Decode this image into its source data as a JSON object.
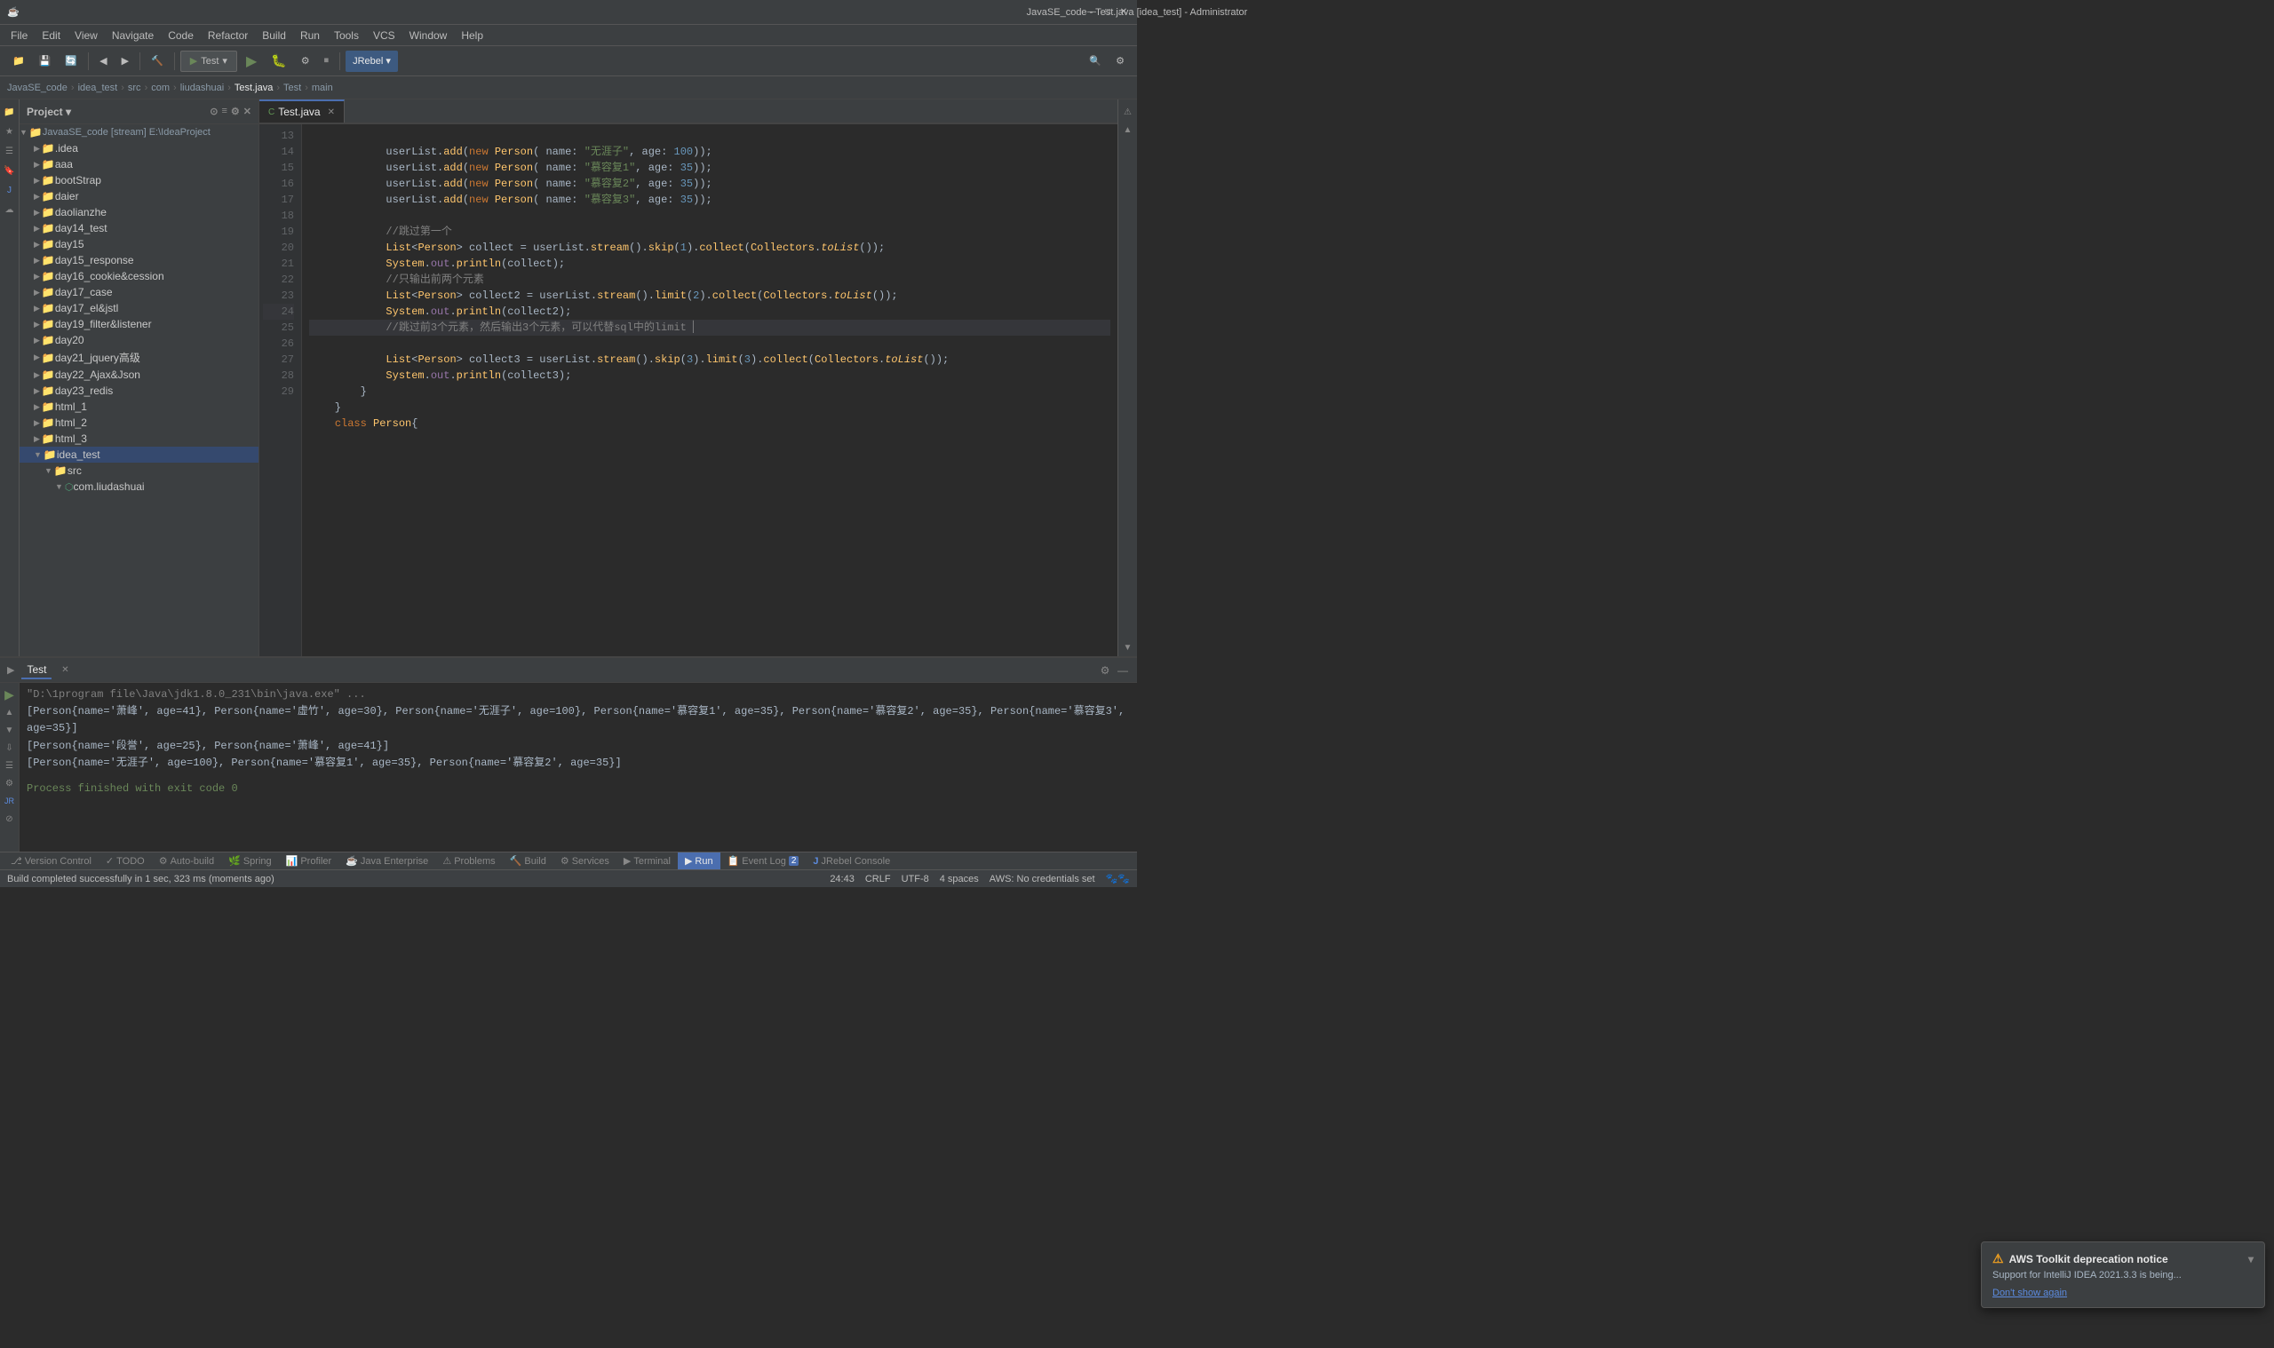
{
  "titlebar": {
    "title": "JavaSE_code - Test.java [idea_test] - Administrator",
    "app_icon": "☕",
    "controls": [
      "—",
      "□",
      "✕"
    ]
  },
  "menubar": {
    "items": [
      "File",
      "Edit",
      "View",
      "Navigate",
      "Code",
      "Refactor",
      "Build",
      "Run",
      "Tools",
      "VCS",
      "Window",
      "Help"
    ]
  },
  "toolbar": {
    "run_config": "Test",
    "jrebel": "JRebel ▾"
  },
  "breadcrumb": {
    "items": [
      "JavaSE_code",
      "idea_test",
      "src",
      "com",
      "liudashuai",
      "Test.java",
      "Test",
      "main"
    ]
  },
  "project_panel": {
    "title": "Project",
    "root": "JavaaSE_code [stream]  E:\\IdeaProject",
    "items": [
      {
        "label": ".idea",
        "indent": 1,
        "type": "folder",
        "collapsed": true
      },
      {
        "label": "aaa",
        "indent": 1,
        "type": "folder",
        "collapsed": true
      },
      {
        "label": "bootStrap",
        "indent": 1,
        "type": "folder",
        "collapsed": true
      },
      {
        "label": "daier",
        "indent": 1,
        "type": "folder",
        "collapsed": true
      },
      {
        "label": "daolianzhe",
        "indent": 1,
        "type": "folder",
        "collapsed": true
      },
      {
        "label": "day14_test",
        "indent": 1,
        "type": "folder",
        "collapsed": true
      },
      {
        "label": "day15",
        "indent": 1,
        "type": "folder",
        "collapsed": true
      },
      {
        "label": "day15_response",
        "indent": 1,
        "type": "folder",
        "collapsed": true
      },
      {
        "label": "day16_cookie&cession",
        "indent": 1,
        "type": "folder",
        "collapsed": true
      },
      {
        "label": "day17_case",
        "indent": 1,
        "type": "folder",
        "collapsed": true
      },
      {
        "label": "day17_el&jstl",
        "indent": 1,
        "type": "folder",
        "collapsed": true
      },
      {
        "label": "day19_filter&listener",
        "indent": 1,
        "type": "folder",
        "collapsed": true
      },
      {
        "label": "day20",
        "indent": 1,
        "type": "folder",
        "collapsed": true
      },
      {
        "label": "day21_jquery高级",
        "indent": 1,
        "type": "folder",
        "collapsed": true
      },
      {
        "label": "day22_Ajax&Json",
        "indent": 1,
        "type": "folder",
        "collapsed": true
      },
      {
        "label": "day23_redis",
        "indent": 1,
        "type": "folder",
        "collapsed": true
      },
      {
        "label": "html_1",
        "indent": 1,
        "type": "folder",
        "collapsed": true
      },
      {
        "label": "html_2",
        "indent": 1,
        "type": "folder",
        "collapsed": true
      },
      {
        "label": "html_3",
        "indent": 1,
        "type": "folder",
        "collapsed": true
      },
      {
        "label": "idea_test",
        "indent": 1,
        "type": "folder",
        "expanded": true
      },
      {
        "label": "src",
        "indent": 2,
        "type": "folder",
        "expanded": true
      },
      {
        "label": "com.liudashuai",
        "indent": 3,
        "type": "package",
        "expanded": true
      }
    ]
  },
  "editor": {
    "tab_label": "Test.java",
    "tab_icon": "C",
    "lines": [
      {
        "num": 13,
        "code": "            userList.add(new Person( name: \"无涯子\", age: 100));"
      },
      {
        "num": 14,
        "code": "            userList.add(new Person( name: \"慕容复1\", age: 35));"
      },
      {
        "num": 15,
        "code": "            userList.add(new Person( name: \"慕容复2\", age: 35));"
      },
      {
        "num": 16,
        "code": "            userList.add(new Person( name: \"慕容复3\", age: 35));"
      },
      {
        "num": 17,
        "code": ""
      },
      {
        "num": 18,
        "code": "            //跳过第一个"
      },
      {
        "num": 19,
        "code": "            List<Person> collect = userList.stream().skip(1).collect(Collectors.toList());"
      },
      {
        "num": 20,
        "code": "            System.out.println(collect);"
      },
      {
        "num": 21,
        "code": "            //只输出前两个元素"
      },
      {
        "num": 22,
        "code": "            List<Person> collect2 = userList.stream().limit(2).collect(Collectors.toList());"
      },
      {
        "num": 23,
        "code": "            System.out.println(collect2);"
      },
      {
        "num": 24,
        "code": "            //跳过前3个元素，然后输出3个元素，可以代替sql中的limit ▏"
      },
      {
        "num": 25,
        "code": "            List<Person> collect3 = userList.stream().skip(3).limit(3).collect(Collectors.toList());"
      },
      {
        "num": 26,
        "code": "            System.out.println(collect3);"
      },
      {
        "num": 27,
        "code": "        }"
      },
      {
        "num": 28,
        "code": "    }"
      },
      {
        "num": 29,
        "code": "    class Person{"
      }
    ]
  },
  "run_panel": {
    "tab_label": "Test",
    "command_line": "\"D:\\1program file\\Java\\jdk1.8.0_231\\bin\\java.exe\" ...",
    "output_lines": [
      "[Person{name='萧峰', age=41}, Person{name='虚竹', age=30}, Person{name='无涯子', age=100}, Person{name='慕容复1', age=35}, Person{name='慕容复2', age=35}, Person{name='慕容复3', age=35}]",
      "[Person{name='段誉', age=25}, Person{name='萧峰', age=41}]",
      "[Person{name='无涯子', age=100}, Person{name='慕容复1', age=35}, Person{name='慕容复2', age=35}]"
    ],
    "finish_msg": "Process finished with exit code 0"
  },
  "bottom_tabs": {
    "items": [
      {
        "label": "Version Control",
        "icon": "⎇",
        "active": false
      },
      {
        "label": "TODO",
        "icon": "✓",
        "active": false
      },
      {
        "label": "Auto-build",
        "icon": "⚙",
        "active": false
      },
      {
        "label": "Spring",
        "icon": "🌱",
        "active": false
      },
      {
        "label": "Profiler",
        "icon": "📊",
        "active": false
      },
      {
        "label": "Java Enterprise",
        "icon": "☕",
        "active": false
      },
      {
        "label": "Problems",
        "icon": "⚠",
        "badge": "",
        "active": false
      },
      {
        "label": "Build",
        "icon": "🔨",
        "active": false
      },
      {
        "label": "Services",
        "icon": "⚙",
        "active": false
      },
      {
        "label": "Terminal",
        "icon": "▶",
        "active": false
      },
      {
        "label": "Run",
        "icon": "▶",
        "active": true
      },
      {
        "label": "Event Log",
        "icon": "📋",
        "badge": "2",
        "active": false
      },
      {
        "label": "JRebel Console",
        "icon": "J",
        "active": false
      }
    ]
  },
  "statusbar": {
    "build_msg": "Build completed successfully in 1 sec, 323 ms (moments ago)",
    "position": "24:43",
    "encoding": "CRLF",
    "charset": "UTF-8",
    "indent": "4 spaces",
    "aws": "AWS: No credentials set",
    "warning_icon": "⚠"
  },
  "aws_notification": {
    "title": "AWS Toolkit deprecation notice",
    "body": "Support for IntelliJ IDEA 2021.3.3 is being...",
    "dont_show": "Don't show again"
  }
}
